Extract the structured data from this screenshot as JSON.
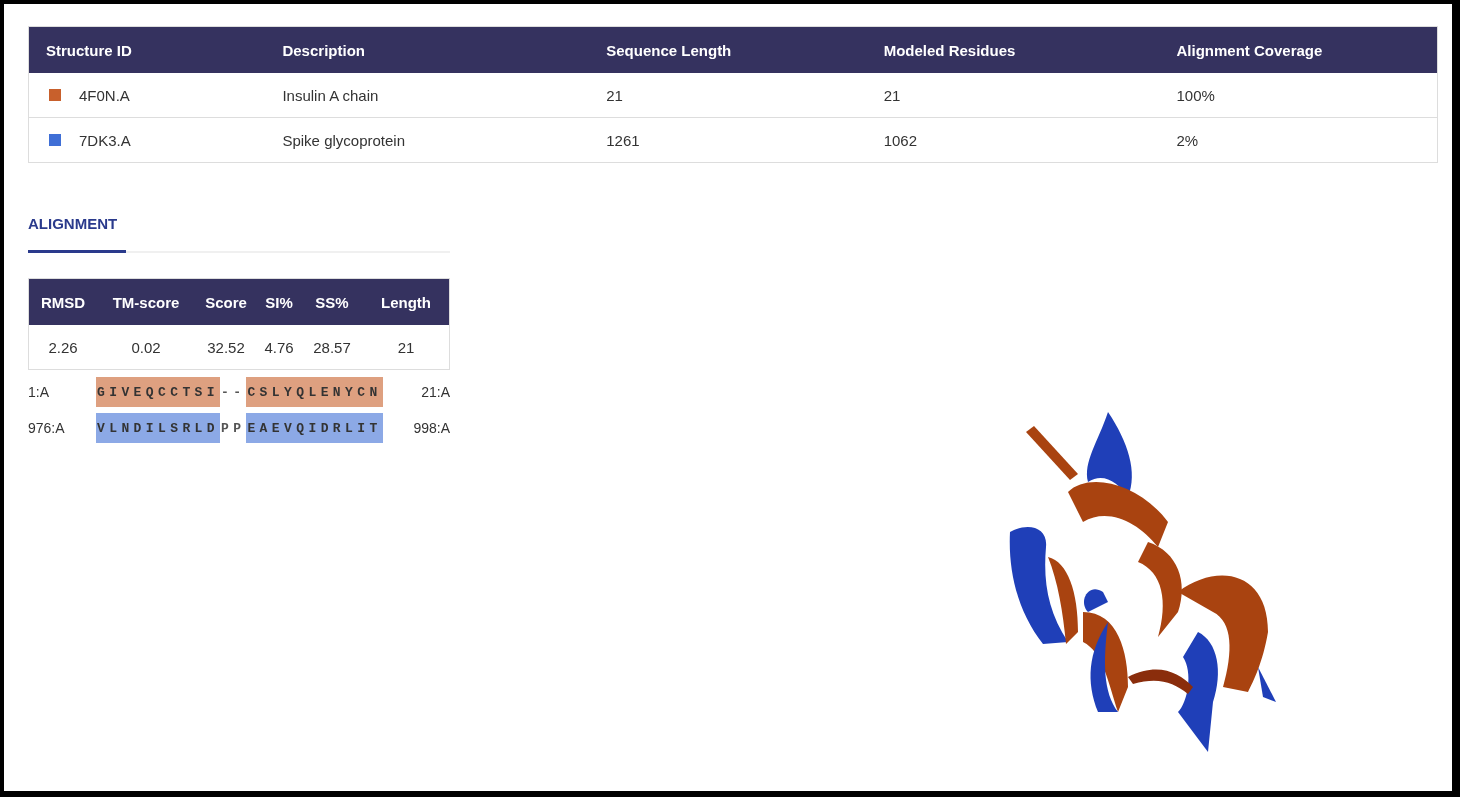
{
  "structures_table": {
    "columns": [
      "Structure ID",
      "Description",
      "Sequence Length",
      "Modeled Residues",
      "Alignment Coverage"
    ],
    "rows": [
      {
        "id": "4F0N.A",
        "description": "Insulin A chain",
        "sequence_length": "21",
        "modeled_residues": "21",
        "coverage": "100%",
        "color": "#c8602c"
      },
      {
        "id": "7DK3.A",
        "description": "Spike glycoprotein",
        "sequence_length": "1261",
        "modeled_residues": "1062",
        "coverage": "2%",
        "color": "#3f6fd6"
      }
    ]
  },
  "tabs": [
    {
      "label": "ALIGNMENT",
      "selected": true
    }
  ],
  "metrics_table": {
    "columns": [
      "RMSD",
      "TM-score",
      "Score",
      "SI%",
      "SS%",
      "Length"
    ],
    "values": [
      "2.26",
      "0.02",
      "32.52",
      "4.76",
      "28.57",
      "21"
    ]
  },
  "alignment": [
    {
      "start": "1:A",
      "end": "21:A",
      "segments": [
        {
          "text": "GIVEQCCTSI",
          "aligned": true
        },
        {
          "text": "--",
          "aligned": false
        },
        {
          "text": "CSLYQLENYCN",
          "aligned": true
        }
      ]
    },
    {
      "start": "976:A",
      "end": "998:A",
      "segments": [
        {
          "text": "VLNDILSRLD",
          "aligned": true
        },
        {
          "text": "PP",
          "aligned": false
        },
        {
          "text": "EAEVQIDRLIT",
          "aligned": true
        }
      ]
    }
  ]
}
